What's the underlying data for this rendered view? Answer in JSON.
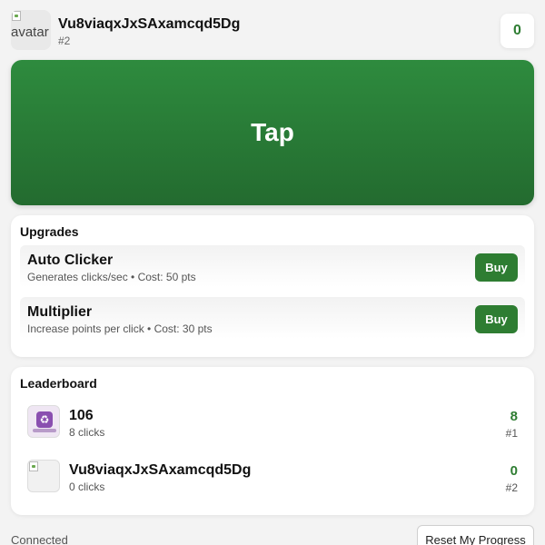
{
  "header": {
    "avatar_alt": "avatar",
    "username": "Vu8viaqxJxSAxamcqd5Dg",
    "rank": "#2",
    "score": "0"
  },
  "tap": {
    "label": "Tap"
  },
  "upgrades": {
    "title": "Upgrades",
    "items": [
      {
        "name": "Auto Clicker",
        "description": "Generates clicks/sec • Cost: 50 pts",
        "button": "Buy"
      },
      {
        "name": "Multiplier",
        "description": "Increase points per click • Cost: 30 pts",
        "button": "Buy"
      }
    ]
  },
  "leaderboard": {
    "title": "Leaderboard",
    "entries": [
      {
        "name": "106",
        "clicks": "8 clicks",
        "score": "8",
        "rank": "#1",
        "avatar_icon": "recycle-icon"
      },
      {
        "name": "Vu8viaqxJxSAxamcqd5Dg",
        "clicks": "0 clicks",
        "score": "0",
        "rank": "#2",
        "avatar_icon": "broken-image-icon"
      }
    ]
  },
  "footer": {
    "status": "Connected",
    "reset_label": "Reset My Progress"
  },
  "colors": {
    "accent": "#2e7d32",
    "tap_gradient_top": "#2e8b3e",
    "tap_gradient_bottom": "#236b2f",
    "background": "#f3f3f3"
  }
}
